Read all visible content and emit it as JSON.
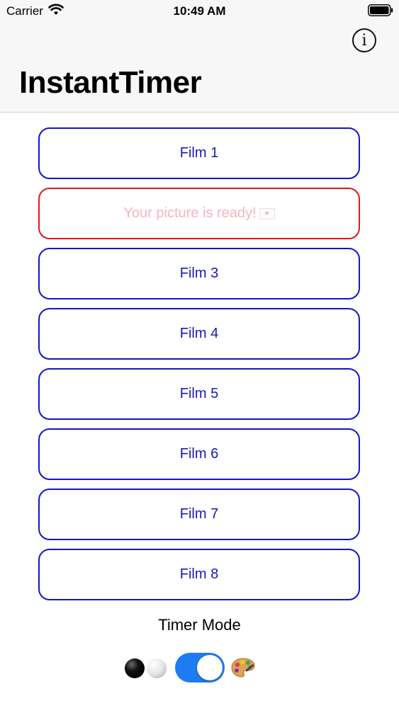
{
  "status_bar": {
    "carrier": "Carrier",
    "time": "10:49 AM",
    "wifi_icon": "wifi-icon",
    "battery_icon": "battery-icon"
  },
  "nav": {
    "title": "InstantTimer",
    "info_glyph": "i"
  },
  "films": [
    {
      "label": "Film 1",
      "state": "normal"
    },
    {
      "label": "Your picture is ready!",
      "state": "ready"
    },
    {
      "label": "Film 3",
      "state": "normal"
    },
    {
      "label": "Film 4",
      "state": "normal"
    },
    {
      "label": "Film 5",
      "state": "normal"
    },
    {
      "label": "Film 6",
      "state": "normal"
    },
    {
      "label": "Film 7",
      "state": "normal"
    },
    {
      "label": "Film 8",
      "state": "normal"
    }
  ],
  "timer_mode": {
    "label": "Timer Mode",
    "left_icon": "black-white-icon",
    "right_icon": "palette-icon",
    "toggle_on": true
  },
  "colors": {
    "accent": "#1515c8",
    "ready_border": "#e51717",
    "ready_text": "#f6b5c2",
    "toggle_on": "#1d7cf2"
  }
}
